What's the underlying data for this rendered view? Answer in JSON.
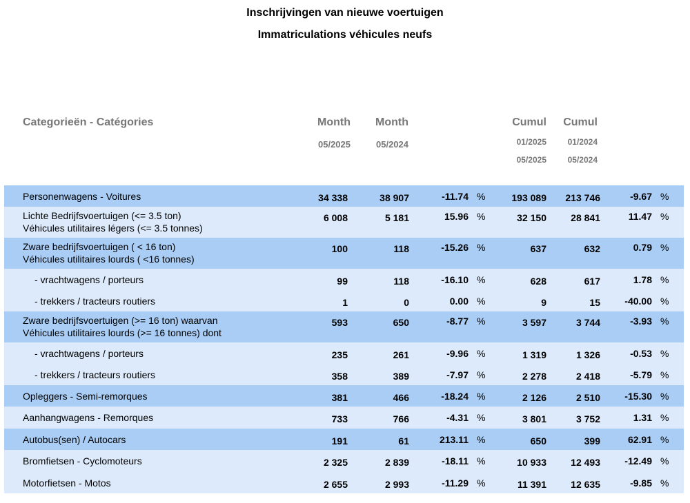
{
  "title_nl": "Inschrijvingen van nieuwe voertuigen",
  "title_fr": "Immatriculations véhicules neufs",
  "headers": {
    "category": "Categorieën - Catégories",
    "month1": "Month",
    "month1_period": "05/2025",
    "month2": "Month",
    "month2_period": "05/2024",
    "cumul1": "Cumul",
    "cumul1_from": "01/2025",
    "cumul1_to": "05/2025",
    "cumul2": "Cumul",
    "cumul2_from": "01/2024",
    "cumul2_to": "05/2024"
  },
  "rows": [
    {
      "label1": "Personenwagens - Voitures",
      "label2": "",
      "m2025": "34 338",
      "m2024": "38 907",
      "mdiff": "-11.74",
      "pct1": "%",
      "c2025": "193 089",
      "c2024": "213 746",
      "cdiff": "-9.67",
      "pct2": "%",
      "bg": "dark"
    },
    {
      "label1": "Lichte Bedrijfsvoertuigen (<= 3.5 ton)",
      "label2": "Véhicules utilitaires légers (<= 3.5 tonnes)",
      "m2025": "6 008",
      "m2024": "5 181",
      "mdiff": "15.96",
      "pct1": "%",
      "c2025": "32 150",
      "c2024": "28 841",
      "cdiff": "11.47",
      "pct2": "%",
      "bg": "light"
    },
    {
      "label1": "Zware bedrijfsvoertuigen ( < 16 ton)",
      "label2": "Véhicules utilitaires lourds ( <16 tonnes)",
      "m2025": "100",
      "m2024": "118",
      "mdiff": "-15.26",
      "pct1": "%",
      "c2025": "637",
      "c2024": "632",
      "cdiff": "0.79",
      "pct2": "%",
      "bg": "dark"
    },
    {
      "label1": "- vrachtwagens / porteurs",
      "label2": "",
      "m2025": "99",
      "m2024": "118",
      "mdiff": "-16.10",
      "pct1": "%",
      "c2025": "628",
      "c2024": "617",
      "cdiff": "1.78",
      "pct2": "%",
      "bg": "light",
      "sub": true
    },
    {
      "label1": "- trekkers / tracteurs routiers",
      "label2": "",
      "m2025": "1",
      "m2024": "0",
      "mdiff": "0.00",
      "pct1": "%",
      "c2025": "9",
      "c2024": "15",
      "cdiff": "-40.00",
      "pct2": "%",
      "bg": "light",
      "sub": true
    },
    {
      "label1": "Zware bedrijfsvoertuigen (>= 16 ton) waarvan",
      "label2": "Véhicules utilitaires lourds (>= 16 tonnes) dont",
      "m2025": "593",
      "m2024": "650",
      "mdiff": "-8.77",
      "pct1": "%",
      "c2025": "3 597",
      "c2024": "3 744",
      "cdiff": "-3.93",
      "pct2": "%",
      "bg": "dark"
    },
    {
      "label1": "- vrachtwagens / porteurs",
      "label2": "",
      "m2025": "235",
      "m2024": "261",
      "mdiff": "-9.96",
      "pct1": "%",
      "c2025": "1 319",
      "c2024": "1 326",
      "cdiff": "-0.53",
      "pct2": "%",
      "bg": "light",
      "sub": true
    },
    {
      "label1": "- trekkers / tracteurs routiers",
      "label2": "",
      "m2025": "358",
      "m2024": "389",
      "mdiff": "-7.97",
      "pct1": "%",
      "c2025": "2 278",
      "c2024": "2 418",
      "cdiff": "-5.79",
      "pct2": "%",
      "bg": "light",
      "sub": true
    },
    {
      "label1": "Opleggers - Semi-remorques",
      "label2": "",
      "m2025": "381",
      "m2024": "466",
      "mdiff": "-18.24",
      "pct1": "%",
      "c2025": "2 126",
      "c2024": "2 510",
      "cdiff": "-15.30",
      "pct2": "%",
      "bg": "dark"
    },
    {
      "label1": "Aanhangwagens - Remorques",
      "label2": "",
      "m2025": "733",
      "m2024": "766",
      "mdiff": "-4.31",
      "pct1": "%",
      "c2025": "3 801",
      "c2024": "3 752",
      "cdiff": "1.31",
      "pct2": "%",
      "bg": "light"
    },
    {
      "label1": "Autobus(sen) / Autocars",
      "label2": "",
      "m2025": "191",
      "m2024": "61",
      "mdiff": "213.11",
      "pct1": "%",
      "c2025": "650",
      "c2024": "399",
      "cdiff": "62.91",
      "pct2": "%",
      "bg": "dark"
    },
    {
      "label1": "Bromfietsen - Cyclomoteurs",
      "label2": "",
      "m2025": "2 325",
      "m2024": "2 839",
      "mdiff": "-18.11",
      "pct1": "%",
      "c2025": "10 933",
      "c2024": "12 493",
      "cdiff": "-12.49",
      "pct2": "%",
      "bg": "light"
    },
    {
      "label1": "Motorfietsen - Motos",
      "label2": "",
      "m2025": "2 655",
      "m2024": "2 993",
      "mdiff": "-11.29",
      "pct1": "%",
      "c2025": "11 391",
      "c2024": "12 635",
      "cdiff": "-9.85",
      "pct2": "%",
      "bg": "light"
    }
  ]
}
